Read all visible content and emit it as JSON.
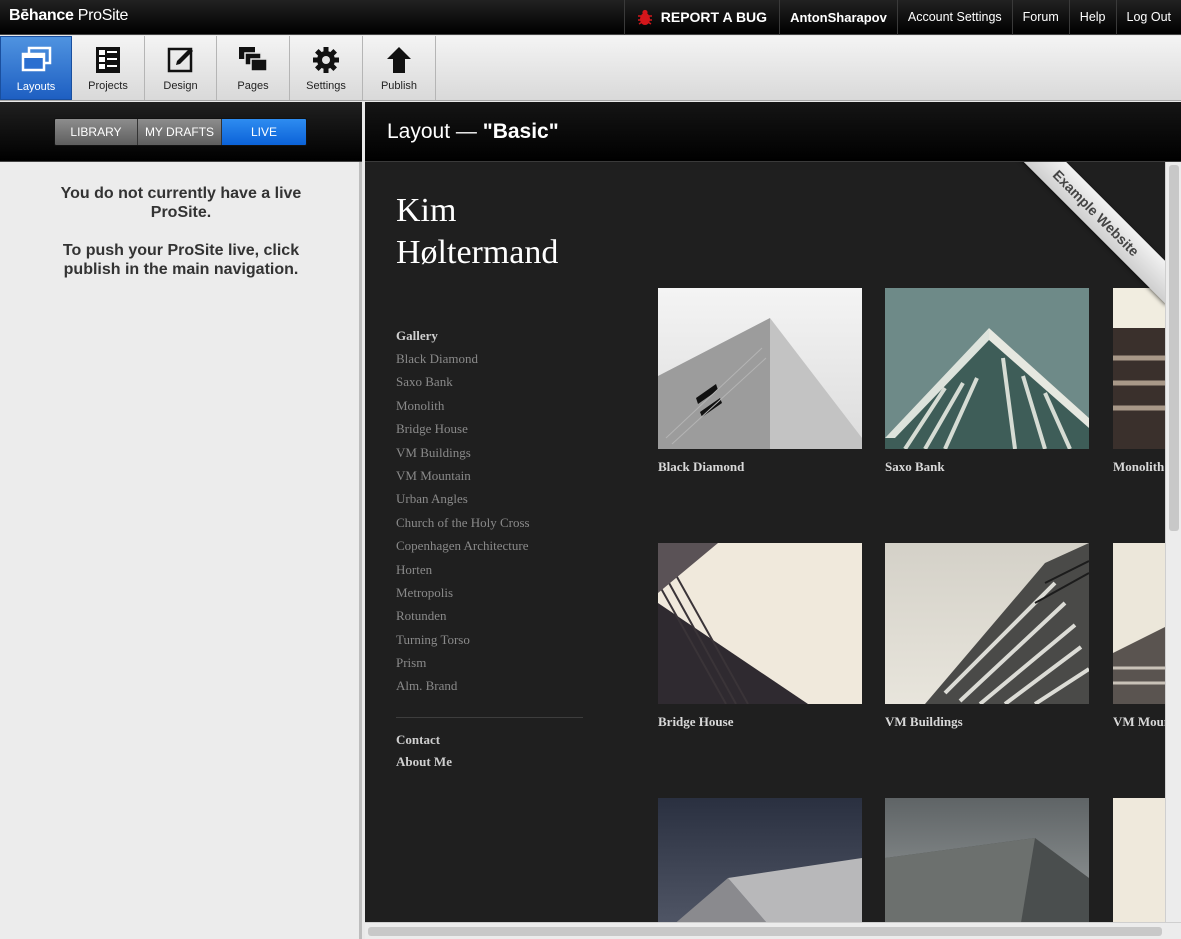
{
  "brand": {
    "name_bold": "Bēhance",
    "name_light": " ProSite"
  },
  "topnav": {
    "report_bug": "REPORT A BUG",
    "user": "AntonSharapov",
    "account_settings": "Account Settings",
    "forum": "Forum",
    "help": "Help",
    "logout": "Log Out"
  },
  "toolbar": {
    "layouts": "Layouts",
    "projects": "Projects",
    "design": "Design",
    "pages": "Pages",
    "settings": "Settings",
    "publish": "Publish"
  },
  "left": {
    "tabs": [
      "LIBRARY",
      "MY DRAFTS",
      "LIVE"
    ],
    "active_tab": "LIVE",
    "message_1": "You do not currently have a live ProSite.",
    "message_2": "To push your ProSite live, click publish in the main navigation."
  },
  "right": {
    "title_prefix": "Layout — ",
    "title_name": "\"Basic\"",
    "ribbon": "Example Website",
    "site": {
      "name_line1": "Kim",
      "name_line2": "Høltermand",
      "nav_heading": "Gallery",
      "nav_links": [
        "Black Diamond",
        "Saxo Bank",
        "Monolith",
        "Bridge House",
        "VM Buildings",
        "VM Mountain",
        "Urban Angles",
        "Church of the Holy Cross",
        "Copenhagen Architecture",
        "Horten",
        "Metropolis",
        "Rotunden",
        "Turning Torso",
        "Prism",
        "Alm. Brand"
      ],
      "nav_footer": [
        "Contact",
        "About Me"
      ],
      "tiles": [
        "Black Diamond",
        "Saxo Bank",
        "Monolith",
        "Bridge House",
        "VM Buildings",
        "VM Mountain"
      ]
    }
  },
  "colors": {
    "accent_blue": "#1e5fc2",
    "live_tab": "#0b62d8",
    "dark_bg": "#1f1f1f"
  }
}
